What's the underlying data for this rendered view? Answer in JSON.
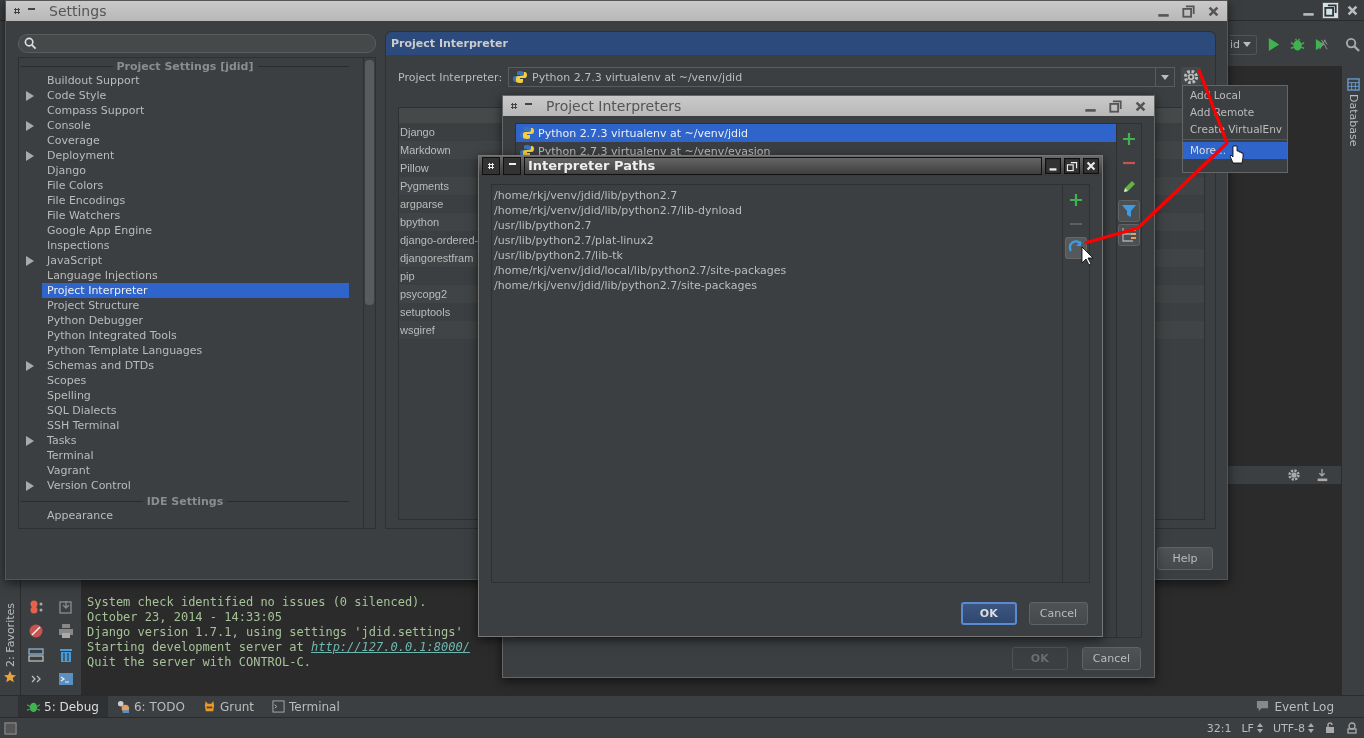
{
  "ide": {
    "toolbar": {
      "run_config": "id"
    },
    "right_tool_tab": "Database",
    "left_tool_tab": "2: Favorites",
    "console": {
      "lines": [
        {
          "text": "System check identified no issues (0 silenced)."
        },
        {
          "text": "October 23, 2014 - 14:33:05"
        },
        {
          "text": "Django version 1.7.1, using settings 'jdid.settings'"
        },
        {
          "text": "Starting development server at ",
          "link": "http://127.0.0.1:8000/"
        },
        {
          "text": "Quit the server with CONTROL-C."
        }
      ]
    },
    "bottom_tabs": [
      {
        "label": "5: Debug",
        "kind": "debug",
        "selected": true
      },
      {
        "label": "6: TODO",
        "kind": "todo",
        "selected": false
      },
      {
        "label": "Grunt",
        "kind": "grunt",
        "selected": false
      },
      {
        "label": "Terminal",
        "kind": "terminal",
        "selected": false
      }
    ],
    "status_bar": {
      "event_log": "Event Log",
      "position": "32:1",
      "line_separator": "LF",
      "encoding": "UTF-8"
    }
  },
  "settings_window": {
    "title": "Settings",
    "sections": [
      {
        "heading": "Project Settings [jdid]",
        "items": [
          {
            "label": "Buildout Support",
            "kind": "leaf",
            "selected": false
          },
          {
            "label": "Code Style",
            "kind": "group",
            "selected": false
          },
          {
            "label": "Compass Support",
            "kind": "leaf",
            "selected": false
          },
          {
            "label": "Console",
            "kind": "group",
            "selected": false
          },
          {
            "label": "Coverage",
            "kind": "leaf",
            "selected": false
          },
          {
            "label": "Deployment",
            "kind": "group",
            "selected": false
          },
          {
            "label": "Django",
            "kind": "leaf",
            "selected": false
          },
          {
            "label": "File Colors",
            "kind": "leaf",
            "selected": false
          },
          {
            "label": "File Encodings",
            "kind": "leaf",
            "selected": false
          },
          {
            "label": "File Watchers",
            "kind": "leaf",
            "selected": false
          },
          {
            "label": "Google App Engine",
            "kind": "leaf",
            "selected": false
          },
          {
            "label": "Inspections",
            "kind": "leaf",
            "selected": false
          },
          {
            "label": "JavaScript",
            "kind": "group",
            "selected": false
          },
          {
            "label": "Language Injections",
            "kind": "leaf",
            "selected": false
          },
          {
            "label": "Project Interpreter",
            "kind": "leaf",
            "selected": true
          },
          {
            "label": "Project Structure",
            "kind": "leaf",
            "selected": false
          },
          {
            "label": "Python Debugger",
            "kind": "leaf",
            "selected": false
          },
          {
            "label": "Python Integrated Tools",
            "kind": "leaf",
            "selected": false
          },
          {
            "label": "Python Template Languages",
            "kind": "leaf",
            "selected": false
          },
          {
            "label": "Schemas and DTDs",
            "kind": "group",
            "selected": false
          },
          {
            "label": "Scopes",
            "kind": "leaf",
            "selected": false
          },
          {
            "label": "Spelling",
            "kind": "leaf",
            "selected": false
          },
          {
            "label": "SQL Dialects",
            "kind": "leaf",
            "selected": false
          },
          {
            "label": "SSH Terminal",
            "kind": "leaf",
            "selected": false
          },
          {
            "label": "Tasks",
            "kind": "group",
            "selected": false
          },
          {
            "label": "Terminal",
            "kind": "leaf",
            "selected": false
          },
          {
            "label": "Vagrant",
            "kind": "leaf",
            "selected": false
          },
          {
            "label": "Version Control",
            "kind": "group",
            "selected": false
          }
        ]
      },
      {
        "heading": "IDE Settings",
        "items": [
          {
            "label": "Appearance",
            "kind": "leaf",
            "selected": false
          }
        ]
      }
    ],
    "panel": {
      "title": "Project Interpreter",
      "interpreter_label": "Project Interpreter:",
      "interpreter": "Python 2.7.3 virtualenv at ~/venv/jdid",
      "packages": [
        "Django",
        "Markdown",
        "Pillow",
        "Pygments",
        "argparse",
        "bpython",
        "django-ordered-",
        "djangorestfram",
        "pip",
        "psycopg2",
        "setuptools",
        "wsgiref"
      ]
    },
    "buttons": [
      "Help"
    ]
  },
  "project_interpreters": {
    "title": "Project Interpreters",
    "interpreters": [
      {
        "name": "Python 2.7.3 virtualenv at ~/venv/jdid",
        "selected": true
      },
      {
        "name": "Python 2.7.3 virtualenv at ~/venv/evasion",
        "selected": false
      }
    ],
    "buttons": [
      {
        "label": "OK",
        "disabled": true
      },
      {
        "label": "Cancel",
        "disabled": false
      }
    ]
  },
  "interpreter_paths": {
    "title": "Interpreter Paths",
    "paths": [
      "/home/rkj/venv/jdid/lib/python2.7",
      "/home/rkj/venv/jdid/lib/python2.7/lib-dynload",
      "/usr/lib/python2.7",
      "/usr/lib/python2.7/plat-linux2",
      "/usr/lib/python2.7/lib-tk",
      "/home/rkj/venv/jdid/local/lib/python2.7/site-packages",
      "/home/rkj/venv/jdid/lib/python2.7/site-packages"
    ],
    "buttons": [
      {
        "label": "OK",
        "default": true
      },
      {
        "label": "Cancel",
        "default": false
      }
    ]
  },
  "gear_menu": {
    "items": [
      {
        "label": "Add Local",
        "selected": false
      },
      {
        "label": "Add Remote",
        "selected": false
      },
      {
        "label": "Create VirtualEnv",
        "selected": false
      },
      {
        "label": "More...",
        "selected": true
      }
    ]
  }
}
